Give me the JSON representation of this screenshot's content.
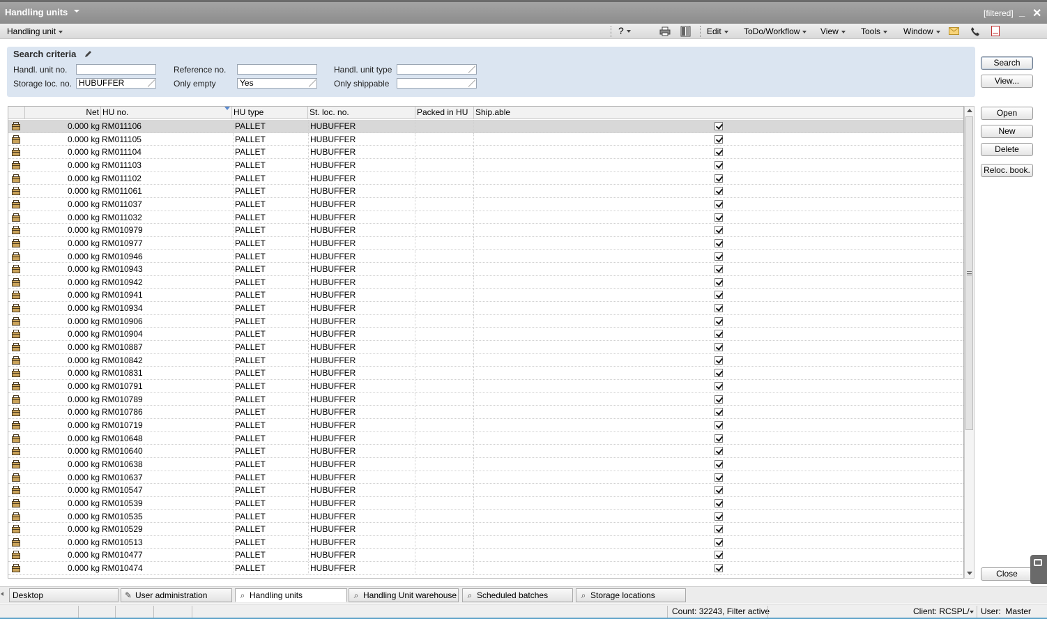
{
  "window": {
    "title": "Handling units",
    "filter_state": "[filtered]",
    "minimize": "_",
    "close": "✕"
  },
  "menubar": {
    "left_menu": "Handling unit",
    "help": "?",
    "items": [
      "Edit",
      "ToDo/Workflow",
      "View",
      "Tools",
      "Window"
    ]
  },
  "search": {
    "title": "Search criteria",
    "handl_unit_no": {
      "label": "Handl. unit no.",
      "value": ""
    },
    "reference_no": {
      "label": "Reference no.",
      "value": ""
    },
    "handl_unit_type": {
      "label": "Handl. unit type",
      "value": ""
    },
    "storage_loc_no": {
      "label": "Storage loc. no.",
      "value": "HUBUFFER"
    },
    "only_empty": {
      "label": "Only empty",
      "value": "Yes"
    },
    "only_shippable": {
      "label": "Only shippable",
      "value": ""
    }
  },
  "actions": {
    "search": "Search",
    "view": "View...",
    "open": "Open",
    "new": "New",
    "delete": "Delete",
    "reloc_book": "Reloc. book.",
    "close": "Close"
  },
  "table": {
    "columns": {
      "net": "Net",
      "hu_no": "HU no.",
      "hu_type": "HU type",
      "st_loc_no": "St. loc. no.",
      "packed_in_hu": "Packed in HU",
      "shipable": "Ship.able"
    },
    "rows": [
      {
        "net": "0.000 kg",
        "hu": "RM011106",
        "type": "PALLET",
        "loc": "HUBUFFER",
        "packed": "",
        "shipable": true
      },
      {
        "net": "0.000 kg",
        "hu": "RM011105",
        "type": "PALLET",
        "loc": "HUBUFFER",
        "packed": "",
        "shipable": true
      },
      {
        "net": "0.000 kg",
        "hu": "RM011104",
        "type": "PALLET",
        "loc": "HUBUFFER",
        "packed": "",
        "shipable": true
      },
      {
        "net": "0.000 kg",
        "hu": "RM011103",
        "type": "PALLET",
        "loc": "HUBUFFER",
        "packed": "",
        "shipable": true
      },
      {
        "net": "0.000 kg",
        "hu": "RM011102",
        "type": "PALLET",
        "loc": "HUBUFFER",
        "packed": "",
        "shipable": true
      },
      {
        "net": "0.000 kg",
        "hu": "RM011061",
        "type": "PALLET",
        "loc": "HUBUFFER",
        "packed": "",
        "shipable": true
      },
      {
        "net": "0.000 kg",
        "hu": "RM011037",
        "type": "PALLET",
        "loc": "HUBUFFER",
        "packed": "",
        "shipable": true
      },
      {
        "net": "0.000 kg",
        "hu": "RM011032",
        "type": "PALLET",
        "loc": "HUBUFFER",
        "packed": "",
        "shipable": true
      },
      {
        "net": "0.000 kg",
        "hu": "RM010979",
        "type": "PALLET",
        "loc": "HUBUFFER",
        "packed": "",
        "shipable": true
      },
      {
        "net": "0.000 kg",
        "hu": "RM010977",
        "type": "PALLET",
        "loc": "HUBUFFER",
        "packed": "",
        "shipable": true
      },
      {
        "net": "0.000 kg",
        "hu": "RM010946",
        "type": "PALLET",
        "loc": "HUBUFFER",
        "packed": "",
        "shipable": true
      },
      {
        "net": "0.000 kg",
        "hu": "RM010943",
        "type": "PALLET",
        "loc": "HUBUFFER",
        "packed": "",
        "shipable": true
      },
      {
        "net": "0.000 kg",
        "hu": "RM010942",
        "type": "PALLET",
        "loc": "HUBUFFER",
        "packed": "",
        "shipable": true
      },
      {
        "net": "0.000 kg",
        "hu": "RM010941",
        "type": "PALLET",
        "loc": "HUBUFFER",
        "packed": "",
        "shipable": true
      },
      {
        "net": "0.000 kg",
        "hu": "RM010934",
        "type": "PALLET",
        "loc": "HUBUFFER",
        "packed": "",
        "shipable": true
      },
      {
        "net": "0.000 kg",
        "hu": "RM010906",
        "type": "PALLET",
        "loc": "HUBUFFER",
        "packed": "",
        "shipable": true
      },
      {
        "net": "0.000 kg",
        "hu": "RM010904",
        "type": "PALLET",
        "loc": "HUBUFFER",
        "packed": "",
        "shipable": true
      },
      {
        "net": "0.000 kg",
        "hu": "RM010887",
        "type": "PALLET",
        "loc": "HUBUFFER",
        "packed": "",
        "shipable": true
      },
      {
        "net": "0.000 kg",
        "hu": "RM010842",
        "type": "PALLET",
        "loc": "HUBUFFER",
        "packed": "",
        "shipable": true
      },
      {
        "net": "0.000 kg",
        "hu": "RM010831",
        "type": "PALLET",
        "loc": "HUBUFFER",
        "packed": "",
        "shipable": true
      },
      {
        "net": "0.000 kg",
        "hu": "RM010791",
        "type": "PALLET",
        "loc": "HUBUFFER",
        "packed": "",
        "shipable": true
      },
      {
        "net": "0.000 kg",
        "hu": "RM010789",
        "type": "PALLET",
        "loc": "HUBUFFER",
        "packed": "",
        "shipable": true
      },
      {
        "net": "0.000 kg",
        "hu": "RM010786",
        "type": "PALLET",
        "loc": "HUBUFFER",
        "packed": "",
        "shipable": true
      },
      {
        "net": "0.000 kg",
        "hu": "RM010719",
        "type": "PALLET",
        "loc": "HUBUFFER",
        "packed": "",
        "shipable": true
      },
      {
        "net": "0.000 kg",
        "hu": "RM010648",
        "type": "PALLET",
        "loc": "HUBUFFER",
        "packed": "",
        "shipable": true
      },
      {
        "net": "0.000 kg",
        "hu": "RM010640",
        "type": "PALLET",
        "loc": "HUBUFFER",
        "packed": "",
        "shipable": true
      },
      {
        "net": "0.000 kg",
        "hu": "RM010638",
        "type": "PALLET",
        "loc": "HUBUFFER",
        "packed": "",
        "shipable": true
      },
      {
        "net": "0.000 kg",
        "hu": "RM010637",
        "type": "PALLET",
        "loc": "HUBUFFER",
        "packed": "",
        "shipable": true
      },
      {
        "net": "0.000 kg",
        "hu": "RM010547",
        "type": "PALLET",
        "loc": "HUBUFFER",
        "packed": "",
        "shipable": true
      },
      {
        "net": "0.000 kg",
        "hu": "RM010539",
        "type": "PALLET",
        "loc": "HUBUFFER",
        "packed": "",
        "shipable": true
      },
      {
        "net": "0.000 kg",
        "hu": "RM010535",
        "type": "PALLET",
        "loc": "HUBUFFER",
        "packed": "",
        "shipable": true
      },
      {
        "net": "0.000 kg",
        "hu": "RM010529",
        "type": "PALLET",
        "loc": "HUBUFFER",
        "packed": "",
        "shipable": true
      },
      {
        "net": "0.000 kg",
        "hu": "RM010513",
        "type": "PALLET",
        "loc": "HUBUFFER",
        "packed": "",
        "shipable": true
      },
      {
        "net": "0.000 kg",
        "hu": "RM010477",
        "type": "PALLET",
        "loc": "HUBUFFER",
        "packed": "",
        "shipable": true
      },
      {
        "net": "0.000 kg",
        "hu": "RM010474",
        "type": "PALLET",
        "loc": "HUBUFFER",
        "packed": "",
        "shipable": true
      }
    ]
  },
  "tabs": [
    {
      "label": "Desktop",
      "icon": "none"
    },
    {
      "label": "User administration",
      "icon": "pencil-icon"
    },
    {
      "label": "Handling units",
      "icon": "search-icon",
      "active": true
    },
    {
      "label": "Handling Unit warehouse l",
      "icon": "search-icon"
    },
    {
      "label": "Scheduled batches",
      "icon": "search-icon"
    },
    {
      "label": "Storage locations",
      "icon": "search-icon"
    }
  ],
  "status": {
    "count": "Count: 32243, Filter active",
    "client": "Client: RCSPL/",
    "user": "User:  Master"
  },
  "colors": {
    "titlebar": "#9a9a9a",
    "search_panel": "#dbe5f1",
    "selected_row": "#d8d8d8",
    "status_accent": "#5fa3c9"
  }
}
